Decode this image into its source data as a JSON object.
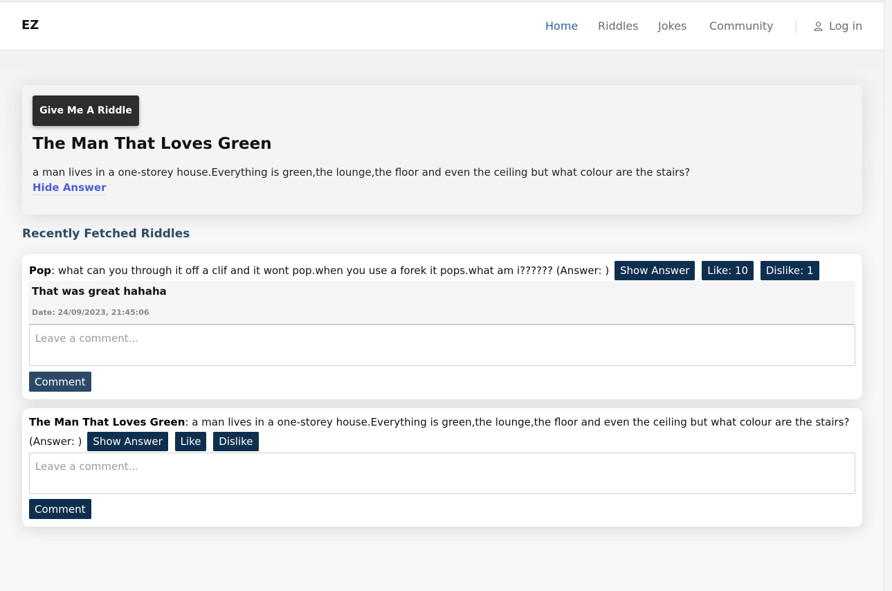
{
  "nav": {
    "brand": "EZ",
    "links": [
      "Home",
      "Riddles",
      "Jokes",
      "Community"
    ],
    "active": "Home",
    "login": "Log in"
  },
  "hero": {
    "button": "Give Me A Riddle",
    "title": "The Man That Loves Green",
    "text": "a man lives in a one-storey house.Everything is green,the lounge,the floor and even the ceiling but what colour are the stairs?",
    "hide_answer": "Hide Answer"
  },
  "recent": {
    "title": "Recently Fetched Riddles",
    "riddles": [
      {
        "name": "Pop",
        "text": ": what can you through it off a clif and it wont pop.when you use a forek it pops.what am i?????? (Answer: )",
        "show_answer": "Show Answer",
        "like": "Like: 10",
        "dislike": "Dislike: 1",
        "comments": [
          {
            "text": "That was great hahaha",
            "date": "Date: 24/09/2023, 21:45:06"
          }
        ],
        "comment_placeholder": "Leave a comment...",
        "comment_button": "Comment"
      },
      {
        "name": "The Man That Loves Green",
        "text": ": a man lives in a one-storey house.Everything is green,the lounge,the floor and even the ceiling but what colour are the stairs? (Answer: )",
        "show_answer": "Show Answer",
        "like": "Like",
        "dislike": "Dislike",
        "comment_placeholder": "Leave a comment...",
        "comment_button": "Comment"
      }
    ]
  },
  "colors": {
    "accent_nav": "#2e5fb0",
    "button_dark": "#0e2f4e",
    "link_blue": "#4b5fd6",
    "section_title": "#2d4a63"
  },
  "icons": {
    "login": "user-icon"
  }
}
